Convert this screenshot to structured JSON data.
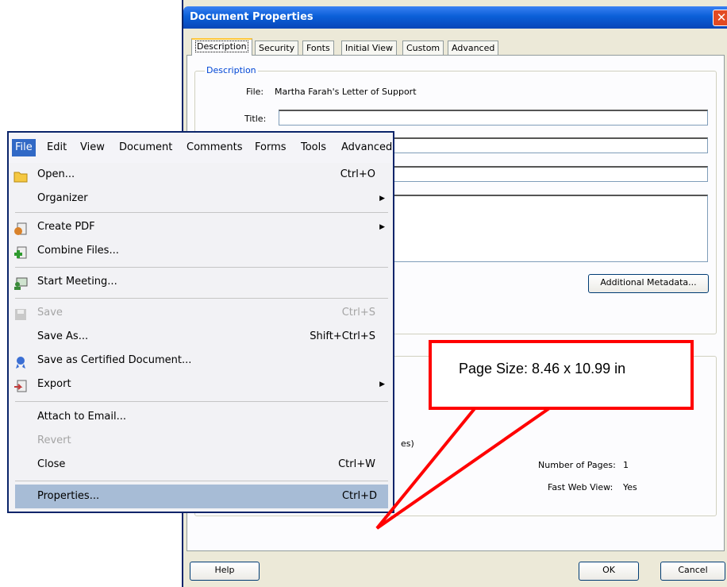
{
  "dialog": {
    "title": "Document Properties",
    "close_glyph": "✕",
    "tabs": [
      "Description",
      "Security",
      "Fonts",
      "Initial View",
      "Custom",
      "Advanced"
    ],
    "active_tab": "Description",
    "description_legend": "Description",
    "file_label": "File:",
    "file_value": "Martha Farah's Letter of Support",
    "title_label": "Title:",
    "title_value": "",
    "additional_metadata_button": "Additional Metadata...",
    "partial_text": "es)",
    "number_of_pages_label": "Number of Pages:",
    "number_of_pages_value": "1",
    "fast_web_view_label": "Fast Web View:",
    "fast_web_view_value": "Yes",
    "help_button": "Help",
    "ok_button": "OK",
    "cancel_button": "Cancel"
  },
  "menubar": [
    "File",
    "Edit",
    "View",
    "Document",
    "Comments",
    "Forms",
    "Tools",
    "Advanced"
  ],
  "file_menu": {
    "open": {
      "label": "Open...",
      "shortcut": "Ctrl+O",
      "icon": "folder-icon"
    },
    "organizer": {
      "label": "Organizer"
    },
    "create_pdf": {
      "label": "Create PDF",
      "icon": "create-pdf-icon"
    },
    "combine_files": {
      "label": "Combine Files...",
      "icon": "combine-files-icon"
    },
    "start_meeting": {
      "label": "Start Meeting...",
      "icon": "meeting-icon"
    },
    "save": {
      "label": "Save",
      "shortcut": "Ctrl+S",
      "icon": "save-icon",
      "disabled": true
    },
    "save_as": {
      "label": "Save As...",
      "shortcut": "Shift+Ctrl+S"
    },
    "save_certified": {
      "label": "Save as Certified Document...",
      "icon": "ribbon-icon"
    },
    "export": {
      "label": "Export",
      "icon": "export-icon"
    },
    "attach_email": {
      "label": "Attach to Email..."
    },
    "revert": {
      "label": "Revert",
      "disabled": true
    },
    "close": {
      "label": "Close",
      "shortcut": "Ctrl+W"
    },
    "properties": {
      "label": "Properties...",
      "shortcut": "Ctrl+D",
      "highlighted": true
    }
  },
  "callout": {
    "text": "Page Size:   8.46 x 10.99 in",
    "color": "#ff0000"
  }
}
